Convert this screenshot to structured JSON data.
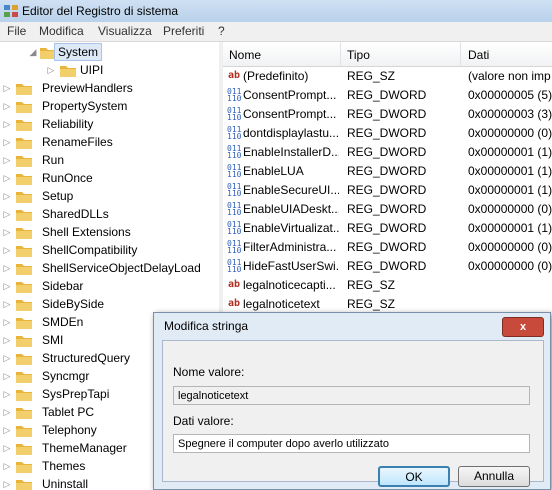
{
  "window": {
    "title": "Editor del Registro di sistema"
  },
  "menu": [
    "File",
    "Modifica",
    "Visualizza",
    "Preferiti",
    "?"
  ],
  "tree": {
    "items": [
      {
        "label": "System",
        "level": 0,
        "expanded": true,
        "selected": true
      },
      {
        "label": "UIPI",
        "level": 1,
        "expanded": false,
        "selected": false
      },
      {
        "label": "PreviewHandlers"
      },
      {
        "label": "PropertySystem"
      },
      {
        "label": "Reliability"
      },
      {
        "label": "RenameFiles"
      },
      {
        "label": "Run"
      },
      {
        "label": "RunOnce"
      },
      {
        "label": "Setup"
      },
      {
        "label": "SharedDLLs"
      },
      {
        "label": "Shell Extensions"
      },
      {
        "label": "ShellCompatibility"
      },
      {
        "label": "ShellServiceObjectDelayLoad"
      },
      {
        "label": "Sidebar"
      },
      {
        "label": "SideBySide"
      },
      {
        "label": "SMDEn"
      },
      {
        "label": "SMI"
      },
      {
        "label": "StructuredQuery"
      },
      {
        "label": "Syncmgr"
      },
      {
        "label": "SysPrepTapi"
      },
      {
        "label": "Tablet PC"
      },
      {
        "label": "Telephony"
      },
      {
        "label": "ThemeManager"
      },
      {
        "label": "Themes"
      },
      {
        "label": "Uninstall"
      }
    ]
  },
  "list": {
    "columns": [
      "Nome",
      "Tipo",
      "Dati"
    ],
    "rows": [
      {
        "icon": "string-value-icon",
        "name": "(Predefinito)",
        "type": "REG_SZ",
        "data": "(valore non imp"
      },
      {
        "icon": "binary-value-icon",
        "name": "ConsentPrompt...",
        "type": "REG_DWORD",
        "data": "0x00000005 (5)"
      },
      {
        "icon": "binary-value-icon",
        "name": "ConsentPrompt...",
        "type": "REG_DWORD",
        "data": "0x00000003 (3)"
      },
      {
        "icon": "binary-value-icon",
        "name": "dontdisplaylastu...",
        "type": "REG_DWORD",
        "data": "0x00000000 (0)"
      },
      {
        "icon": "binary-value-icon",
        "name": "EnableInstallerD...",
        "type": "REG_DWORD",
        "data": "0x00000001 (1)"
      },
      {
        "icon": "binary-value-icon",
        "name": "EnableLUA",
        "type": "REG_DWORD",
        "data": "0x00000001 (1)"
      },
      {
        "icon": "binary-value-icon",
        "name": "EnableSecureUI...",
        "type": "REG_DWORD",
        "data": "0x00000001 (1)"
      },
      {
        "icon": "binary-value-icon",
        "name": "EnableUIADeskt...",
        "type": "REG_DWORD",
        "data": "0x00000000 (0)"
      },
      {
        "icon": "binary-value-icon",
        "name": "EnableVirtualizat...",
        "type": "REG_DWORD",
        "data": "0x00000001 (1)"
      },
      {
        "icon": "binary-value-icon",
        "name": "FilterAdministra...",
        "type": "REG_DWORD",
        "data": "0x00000000 (0)"
      },
      {
        "icon": "binary-value-icon",
        "name": "HideFastUserSwi...",
        "type": "REG_DWORD",
        "data": "0x00000000 (0)"
      },
      {
        "icon": "string-value-icon",
        "name": "legalnoticecapti...",
        "type": "REG_SZ",
        "data": ""
      },
      {
        "icon": "string-value-icon",
        "name": "legalnoticetext",
        "type": "REG_SZ",
        "data": ""
      }
    ]
  },
  "dialog": {
    "title": "Modifica stringa",
    "close_label": "x",
    "name_label": "Nome valore:",
    "name_value": "legalnoticetext",
    "data_label": "Dati valore:",
    "data_value": "Spegnere il computer dopo averlo utilizzato",
    "ok_label": "OK",
    "cancel_label": "Annulla"
  },
  "colors": {
    "selection": "#dde9f7",
    "folder": "#f2c94c",
    "dialog_frame": "#e1ebf6",
    "close_button": "#c74a3a"
  }
}
